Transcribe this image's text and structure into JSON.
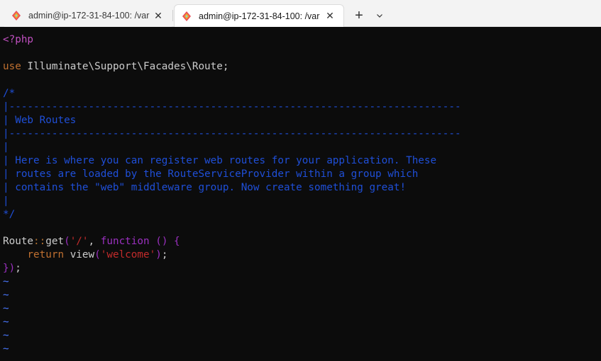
{
  "tabs": [
    {
      "title": "admin@ip-172-31-84-100: /var",
      "close": "✕",
      "icon": "linux-penguin-icon"
    },
    {
      "title": "admin@ip-172-31-84-100: /var",
      "close": "✕",
      "icon": "linux-penguin-icon"
    }
  ],
  "tabbar": {
    "new_tab": "+",
    "dropdown": "dropdown-chevron-icon"
  },
  "editor": {
    "php_open": "<?php",
    "use_kw": "use",
    "use_ns": " Illuminate\\Support\\Facades\\Route;",
    "comment": [
      "/*",
      "|--------------------------------------------------------------------------",
      "| Web Routes",
      "|--------------------------------------------------------------------------",
      "|",
      "| Here is where you can register web routes for your application. These",
      "| routes are loaded by the RouteServiceProvider within a group which",
      "| contains the \"web\" middleware group. Now create something great!",
      "|",
      "*/"
    ],
    "route": {
      "cls": "Route",
      "op": "::",
      "method": "get",
      "paren_open": "(",
      "path": "'/'",
      "comma": ", ",
      "fn_kw": "function",
      "fn_rest": " () {",
      "indent": "    ",
      "ret_kw": "return",
      "view_call": " view",
      "view_paren_open": "(",
      "view_arg": "'welcome'",
      "view_paren_close": ")",
      "semicolon": ";",
      "close_brace": "})",
      "close_semicolon": ";"
    },
    "tildes": [
      "~",
      "~",
      "~",
      "~",
      "~",
      "~"
    ]
  },
  "colors": {
    "background": "#0c0c0c",
    "comment": "#1f4fd8",
    "string": "#c22b2b",
    "keyword": "#9b30c0",
    "use_keyword": "#c07030",
    "tilde": "#4a78ff"
  }
}
